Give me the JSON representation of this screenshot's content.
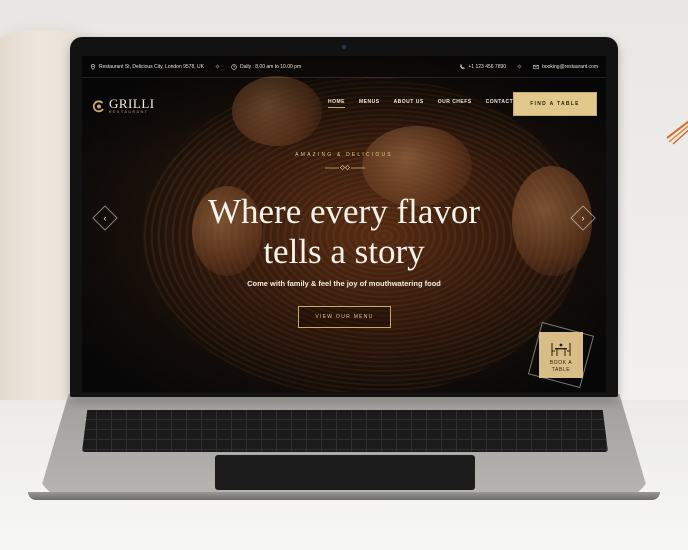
{
  "topbar": {
    "address": "Restaurant St, Delicious City, London 9578, UK",
    "hours": "Daily : 8.00 am to 10.00 pm",
    "phone": "+1 123 456 7890",
    "email": "booking@restaurant.com"
  },
  "brand": {
    "name": "GRILLI",
    "tagline": "RESTAURANT",
    "accent": "#c9a86b"
  },
  "nav": {
    "items": [
      {
        "label": "HOME",
        "active": true
      },
      {
        "label": "MENUS"
      },
      {
        "label": "ABOUT US"
      },
      {
        "label": "OUR CHEFS"
      },
      {
        "label": "CONTACT"
      }
    ],
    "cta": "FIND A TABLE"
  },
  "hero": {
    "eyebrow": "AMAZING & DELICIOUS",
    "headline_line1": "Where every flavor",
    "headline_line2": "tells a story",
    "subtitle": "Come with family & feel the joy of mouthwatering food",
    "button": "VIEW OUR MENU"
  },
  "book_badge": {
    "line1": "BOOK A",
    "line2": "TABLE"
  }
}
